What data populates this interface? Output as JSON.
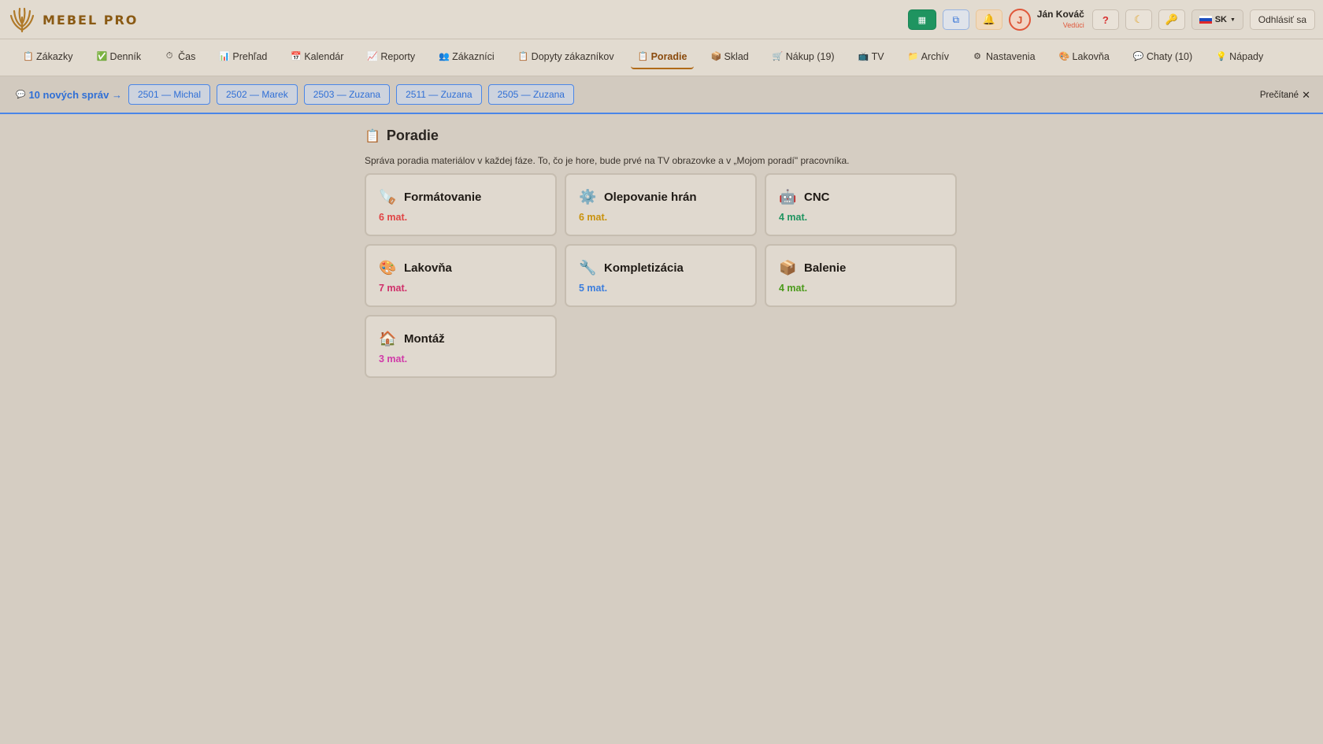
{
  "app": {
    "name": "MEBEL PRO"
  },
  "header": {
    "user_name": "Ján Kováč",
    "user_role": "Vedúci",
    "avatar_initial": "J",
    "help_label": "?",
    "lang_label": "SK",
    "logout_label": "Odhlásiť sa"
  },
  "nav": {
    "items": [
      {
        "label": "Zákazky",
        "icon": "📋"
      },
      {
        "label": "Denník",
        "icon": "✅"
      },
      {
        "label": "Čas",
        "icon": "⏱"
      },
      {
        "label": "Prehľad",
        "icon": "📊"
      },
      {
        "label": "Kalendár",
        "icon": "📅"
      },
      {
        "label": "Reporty",
        "icon": "📈"
      },
      {
        "label": "Zákazníci",
        "icon": "👥"
      },
      {
        "label": "Dopyty zákazníkov",
        "icon": "📋"
      },
      {
        "label": "Poradie",
        "icon": "📋"
      },
      {
        "label": "Sklad",
        "icon": "📦"
      },
      {
        "label": "Nákup (19)",
        "icon": "🛒"
      },
      {
        "label": "TV",
        "icon": "📺"
      },
      {
        "label": "Archív",
        "icon": "📁"
      },
      {
        "label": "Nastavenia",
        "icon": "⚙"
      },
      {
        "label": "Lakovňa",
        "icon": "🎨"
      },
      {
        "label": "Chaty (10)",
        "icon": "💬"
      },
      {
        "label": "Nápady",
        "icon": "💡"
      }
    ],
    "active": "Poradie"
  },
  "messages": {
    "title": "10 nových správ →",
    "chips": [
      "2501 — Michal",
      "2502 — Marek",
      "2503 — Zuzana",
      "2511 — Zuzana",
      "2505 — Zuzana"
    ],
    "read_label": "Prečítané"
  },
  "page": {
    "title": "Poradie",
    "description": "Správa poradia materiálov v každej fáze. To, čo je hore, bude prvé na TV obrazovke a v „Mojom poradí\" pracovníka."
  },
  "phases": [
    {
      "name": "Formátovanie",
      "count": "6 mat.",
      "icon": "🪚",
      "color": "#e04545"
    },
    {
      "name": "Olepovanie hrán",
      "count": "6 mat.",
      "icon": "⚙️",
      "color": "#c9920d"
    },
    {
      "name": "CNC",
      "count": "4 mat.",
      "icon": "🤖",
      "color": "#1f9460"
    },
    {
      "name": "Lakovňa",
      "count": "7 mat.",
      "icon": "🎨",
      "color": "#d0306a"
    },
    {
      "name": "Kompletizácia",
      "count": "5 mat.",
      "icon": "🔧",
      "color": "#3b7ddd"
    },
    {
      "name": "Balenie",
      "count": "4 mat.",
      "icon": "📦",
      "color": "#4a9a1a"
    },
    {
      "name": "Montáž",
      "count": "3 mat.",
      "icon": "🏠",
      "color": "#d03aa8"
    }
  ]
}
